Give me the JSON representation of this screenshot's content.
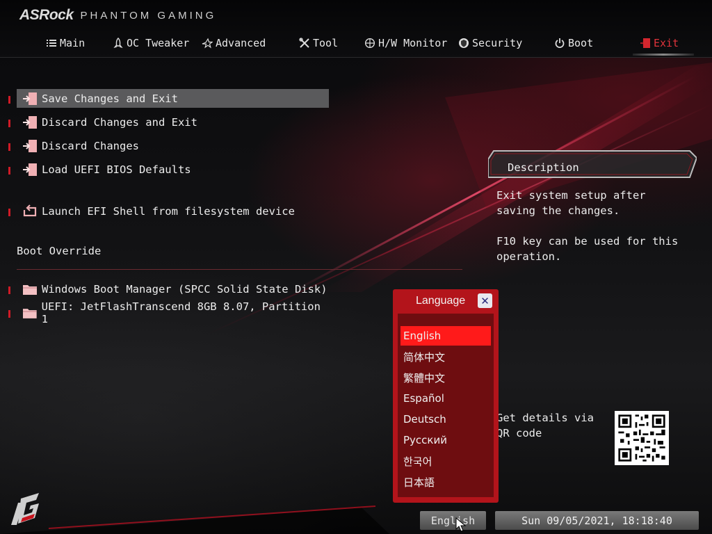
{
  "brand": {
    "name": "ASRock",
    "subtitle": "PHANTOM GAMING"
  },
  "tabs": [
    {
      "label": "Main",
      "icon": "list-icon",
      "active": false
    },
    {
      "label": "OC Tweaker",
      "icon": "rocket-icon",
      "active": false
    },
    {
      "label": "Advanced",
      "icon": "star-icon",
      "active": false
    },
    {
      "label": "Tool",
      "icon": "tools-icon",
      "active": false
    },
    {
      "label": "H/W Monitor",
      "icon": "crosshair-icon",
      "active": false
    },
    {
      "label": "Security",
      "icon": "shield-icon",
      "active": false
    },
    {
      "label": "Boot",
      "icon": "power-icon",
      "active": false
    },
    {
      "label": "Exit",
      "icon": "exit-icon",
      "active": true
    }
  ],
  "menu": {
    "items": [
      {
        "label": "Save Changes and Exit",
        "icon": "exit-door-icon",
        "selected": true
      },
      {
        "label": "Discard Changes and Exit",
        "icon": "exit-door-icon",
        "selected": false
      },
      {
        "label": "Discard Changes",
        "icon": "exit-door-icon",
        "selected": false
      },
      {
        "label": "Load UEFI BIOS Defaults",
        "icon": "exit-door-icon",
        "selected": false
      },
      {
        "label": "Launch EFI Shell from filesystem device",
        "icon": "loop-arrow-icon",
        "selected": false
      }
    ],
    "boot_override_title": "Boot Override",
    "boot_items": [
      {
        "label": "Windows Boot Manager (SPCC Solid State Disk)",
        "icon": "folder-icon"
      },
      {
        "label": "UEFI: JetFlashTranscend 8GB 8.07, Partition 1",
        "icon": "folder-icon"
      }
    ]
  },
  "description": {
    "title": "Description",
    "line1": "Exit system setup after saving the changes.",
    "line2": "F10 key can be used for this operation.",
    "qr_text": "Get details via QR code"
  },
  "language_popup": {
    "title": "Language",
    "close_icon": "close-icon",
    "options": [
      "English",
      "简体中文",
      "繁體中文",
      "Español",
      "Deutsch",
      "Русский",
      "한국어",
      "日本語"
    ],
    "selected": "English"
  },
  "footer": {
    "language_button": "English",
    "datetime": "Sun 09/05/2021, 18:18:40"
  },
  "colors": {
    "accent": "#d01a26",
    "popup": "#b3141b",
    "popup_list": "#6e0d10",
    "selected_option": "#ff1a1a",
    "selected_row": "#5a5a5c"
  }
}
